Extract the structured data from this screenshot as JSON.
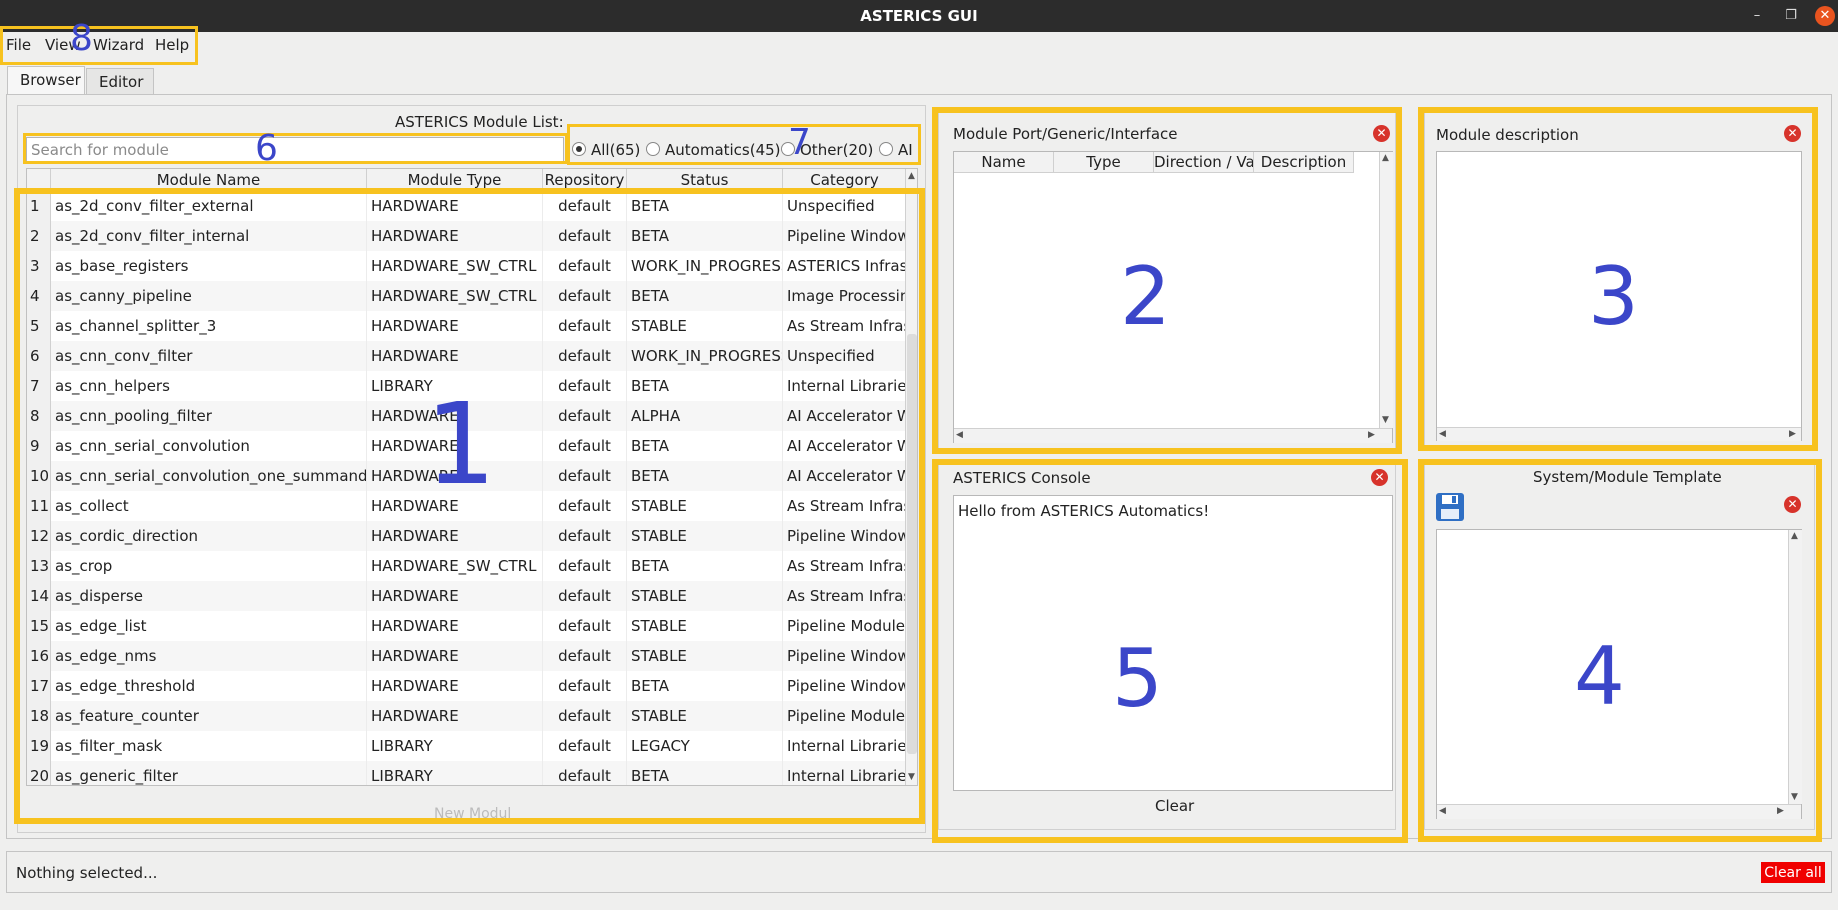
{
  "window": {
    "title": "ASTERICS GUI"
  },
  "menu": [
    {
      "label": "File"
    },
    {
      "label": "View"
    },
    {
      "label": "Wizard"
    },
    {
      "label": "Help"
    }
  ],
  "tabs": [
    {
      "label": "Browser",
      "active": true
    },
    {
      "label": "Editor",
      "active": false
    }
  ],
  "module_list": {
    "title": "ASTERICS Module List:",
    "search_placeholder": "Search for module",
    "filters": [
      {
        "label": "All(65)",
        "selected": true
      },
      {
        "label": "Automatics(45)",
        "selected": false
      },
      {
        "label": "Other(20)",
        "selected": false
      },
      {
        "label": "AI",
        "selected": false
      }
    ],
    "columns": [
      "Module Name",
      "Module Type",
      "Repository",
      "Status",
      "Category"
    ],
    "rows": [
      [
        "1",
        "as_2d_conv_filter_external",
        "HARDWARE",
        "default",
        "BETA",
        "Unspecified"
      ],
      [
        "2",
        "as_2d_conv_filter_internal",
        "HARDWARE",
        "default",
        "BETA",
        "Pipeline Window Filte"
      ],
      [
        "3",
        "as_base_registers",
        "HARDWARE_SW_CTRL",
        "default",
        "WORK_IN_PROGRESS",
        "ASTERICS Infrastructu"
      ],
      [
        "4",
        "as_canny_pipeline",
        "HARDWARE_SW_CTRL",
        "default",
        "BETA",
        "Image Processing Pip"
      ],
      [
        "5",
        "as_channel_splitter_3",
        "HARDWARE",
        "default",
        "STABLE",
        "As Stream Infrastruct"
      ],
      [
        "6",
        "as_cnn_conv_filter",
        "HARDWARE",
        "default",
        "WORK_IN_PROGRESS",
        "Unspecified"
      ],
      [
        "7",
        "as_cnn_helpers",
        "LIBRARY",
        "default",
        "BETA",
        "Internal Libraries"
      ],
      [
        "8",
        "as_cnn_pooling_filter",
        "HARDWARE",
        "default",
        "ALPHA",
        "AI Accelerator Windo"
      ],
      [
        "9",
        "as_cnn_serial_convolution",
        "HARDWARE",
        "default",
        "BETA",
        "AI Accelerator Windo"
      ],
      [
        "10",
        "as_cnn_serial_convolution_one_summand",
        "HARDWARE",
        "default",
        "BETA",
        "AI Accelerator Windo"
      ],
      [
        "11",
        "as_collect",
        "HARDWARE",
        "default",
        "STABLE",
        "As Stream Infrastruct"
      ],
      [
        "12",
        "as_cordic_direction",
        "HARDWARE",
        "default",
        "STABLE",
        "Pipeline Window Filte"
      ],
      [
        "13",
        "as_crop",
        "HARDWARE_SW_CTRL",
        "default",
        "BETA",
        "As Stream Infrastruct"
      ],
      [
        "14",
        "as_disperse",
        "HARDWARE",
        "default",
        "STABLE",
        "As Stream Infrastruct"
      ],
      [
        "15",
        "as_edge_list",
        "HARDWARE",
        "default",
        "STABLE",
        "Pipeline Module"
      ],
      [
        "16",
        "as_edge_nms",
        "HARDWARE",
        "default",
        "STABLE",
        "Pipeline Window Filte"
      ],
      [
        "17",
        "as_edge_threshold",
        "HARDWARE",
        "default",
        "BETA",
        "Pipeline Window Filte"
      ],
      [
        "18",
        "as_feature_counter",
        "HARDWARE",
        "default",
        "STABLE",
        "Pipeline Module"
      ],
      [
        "19",
        "as_filter_mask",
        "LIBRARY",
        "default",
        "LEGACY",
        "Internal Libraries"
      ],
      [
        "20",
        "as_generic_filter",
        "LIBRARY",
        "default",
        "BETA",
        "Internal Libraries"
      ]
    ],
    "new_module_label": "New Modul"
  },
  "port_panel": {
    "title": "Module Port/Generic/Interface",
    "columns": [
      "Name",
      "Type",
      "Direction / Valu",
      "Description"
    ]
  },
  "description_panel": {
    "title": "Module description"
  },
  "console_panel": {
    "title": "ASTERICS  Console",
    "text": "Hello from ASTERICS Automatics!",
    "clear_label": "Clear"
  },
  "template_panel": {
    "title": "System/Module Template"
  },
  "annotations": [
    "1",
    "2",
    "3",
    "4",
    "5",
    "6",
    "7",
    "8"
  ],
  "status_bar": {
    "text": "Nothing selected...",
    "clear_all_label": "Clear all"
  },
  "colors": {
    "highlight": "#f7c21f",
    "annotation": "#3b46c9",
    "close": "#d7332b",
    "clear_all": "#f00000"
  }
}
